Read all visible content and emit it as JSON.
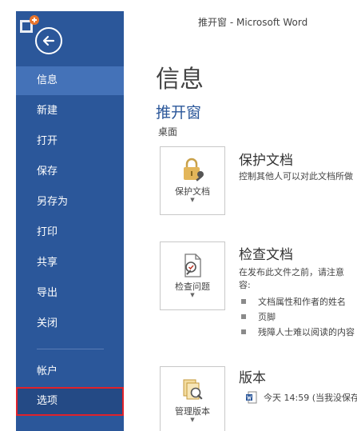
{
  "window": {
    "title": "推开窗 - Microsoft Word"
  },
  "sidebar": {
    "items": [
      {
        "label": "信息"
      },
      {
        "label": "新建"
      },
      {
        "label": "打开"
      },
      {
        "label": "保存"
      },
      {
        "label": "另存为"
      },
      {
        "label": "打印"
      },
      {
        "label": "共享"
      },
      {
        "label": "导出"
      },
      {
        "label": "关闭"
      },
      {
        "label": "帐户"
      },
      {
        "label": "选项"
      }
    ]
  },
  "main": {
    "page_title": "信息",
    "doc_name": "推开窗",
    "doc_location": "桌面",
    "protect": {
      "button_label": "保护文档",
      "title": "保护文档",
      "desc": "控制其他人可以对此文档所做"
    },
    "inspect": {
      "button_label": "检查问题",
      "title": "检查文档",
      "desc_line1": "在发布此文件之前，请注意",
      "desc_line2": "容:",
      "bullets": [
        "文档属性和作者的姓名",
        "页脚",
        "残障人士难以阅读的内容"
      ]
    },
    "versions": {
      "button_label": "管理版本",
      "title": "版本",
      "entry": "今天 14:59 (当我没保存"
    }
  },
  "colors": {
    "sidebar": "#2b579a",
    "sidebar_active": "#4472b8",
    "highlight": "#e0222b"
  }
}
